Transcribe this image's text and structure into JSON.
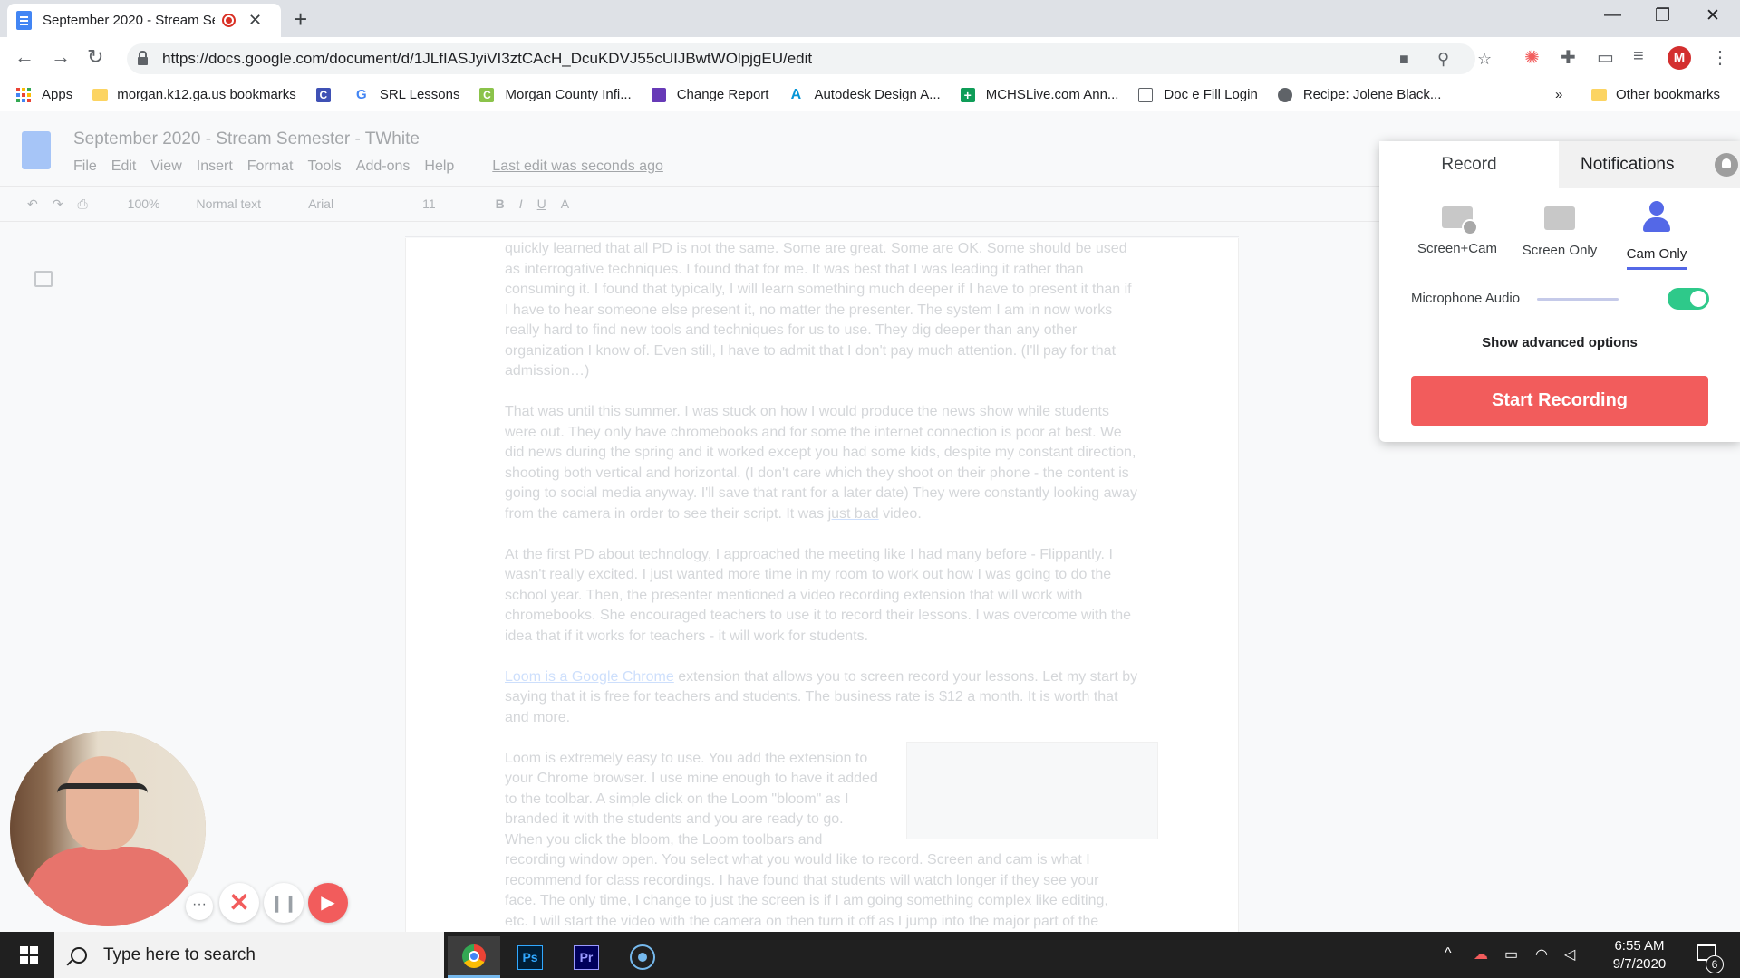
{
  "browser": {
    "tab_title": "September 2020 - Stream Se",
    "url": "https://docs.google.com/document/d/1JLfIASJyiVI3ztCAcH_DcuKDVJ55cUIJBwtWOlpjgEU/edit",
    "bookmarks": [
      {
        "label": "Apps"
      },
      {
        "label": "morgan.k12.ga.us bookmarks"
      },
      {
        "label": "SRL Lessons"
      },
      {
        "label": "Morgan County Infi..."
      },
      {
        "label": "Change Report"
      },
      {
        "label": "Autodesk Design A..."
      },
      {
        "label": "MCHSLive.com Ann..."
      },
      {
        "label": "Doc e Fill Login"
      },
      {
        "label": "Recipe: Jolene Black..."
      }
    ],
    "bookmarks_overflow": "»",
    "other_bookmarks": "Other bookmarks"
  },
  "docs": {
    "title": "September 2020 - Stream Semester - TWhite",
    "menu": [
      "File",
      "Edit",
      "View",
      "Insert",
      "Format",
      "Tools",
      "Add-ons",
      "Help"
    ],
    "last_edit": "Last edit was seconds ago",
    "toolbar": {
      "zoom": "100%",
      "style": "Normal text",
      "font": "Arial",
      "size": "11"
    },
    "paragraphs": {
      "p1": "quickly learned that all PD is not the same. Some are great. Some are OK. Some should be used as interrogative techniques. I found that for me. It was best that I was leading it rather than consuming it. I found that typically, I will learn something much deeper if I have to present it than if I have to hear someone else present it, no matter the presenter. The system I am in now works really hard to find new tools and techniques for us to use. They dig deeper than any other organization I know of. Even still, I have to admit that I don't pay much attention. (I'll pay for that admission…)",
      "p2": "That was until this summer. I was stuck on how I would produce the news show while students were out. They only have chromebooks and for some the internet connection is poor at best. We did news during the spring and it worked except you had some kids, despite my constant direction, shooting both vertical and horizontal. (I don't care which they shoot on their phone - the content is going to social media anyway. I'll save that rant for a later date) They were constantly looking away from the camera in order to see their script. It was ",
      "p2_underlined": "just bad",
      "p2_end": " video.",
      "p3": "At the first PD about technology, I approached the meeting like I had many before -  Flippantly. I wasn't really excited. I just wanted more time in my room to work out how I was going to do the school year. Then, the presenter mentioned a video recording extension that will work with chromebooks. She encouraged teachers to use it to record their lessons. I was overcome with the idea that if it works for teachers - it will work for students.",
      "p4_link": "Loom is a Google Chrome",
      "p4": " extension that allows you to screen record your lessons. Let my start by saying that it is free for teachers and students. The business rate is $12 a month. It is worth that and more.",
      "p5_lines": [
        "Loom is extremely easy to use. You add the extension to",
        "your Chrome browser. I use mine enough to have it added",
        "to the toolbar. A simple click on the Loom \"bloom\" as I",
        "branded it with the students and you are ready to go.",
        "When you click the bloom, the Loom toolbars and",
        "recording window open. You select what you would like to record. Screen and cam is what I",
        "recommend for class recordings. I have found that students will watch longer if they see your",
        "face. The only ",
        "time, I",
        " change to just the screen is if I am going something complex like editing,",
        "etc. I will start the video with the camera on then turn it off as I jump into the major part of the"
      ]
    }
  },
  "loom": {
    "tab_record": "Record",
    "tab_notifications": "Notifications",
    "modes": [
      {
        "label": "Screen+Cam",
        "icon": "screen-cam-icon"
      },
      {
        "label": "Screen Only",
        "icon": "screen-icon"
      },
      {
        "label": "Cam Only",
        "icon": "cam-icon"
      }
    ],
    "selected_mode": "Cam Only",
    "mic_label": "Microphone Audio",
    "mic_enabled": true,
    "advanced": "Show advanced options",
    "start": "Start Recording",
    "accent": "#5468e7",
    "start_color": "#f25c5c",
    "toggle_color": "#2ec98a"
  },
  "controls": {
    "more": "···",
    "cancel": "✕",
    "pause": "❙❙",
    "record": "▶"
  },
  "taskbar": {
    "search_placeholder": "Type here to search",
    "time": "6:55 AM",
    "date": "9/7/2020",
    "notification_count": "6",
    "apps": [
      "Chrome",
      "Ps",
      "Pr",
      "Loom"
    ]
  }
}
